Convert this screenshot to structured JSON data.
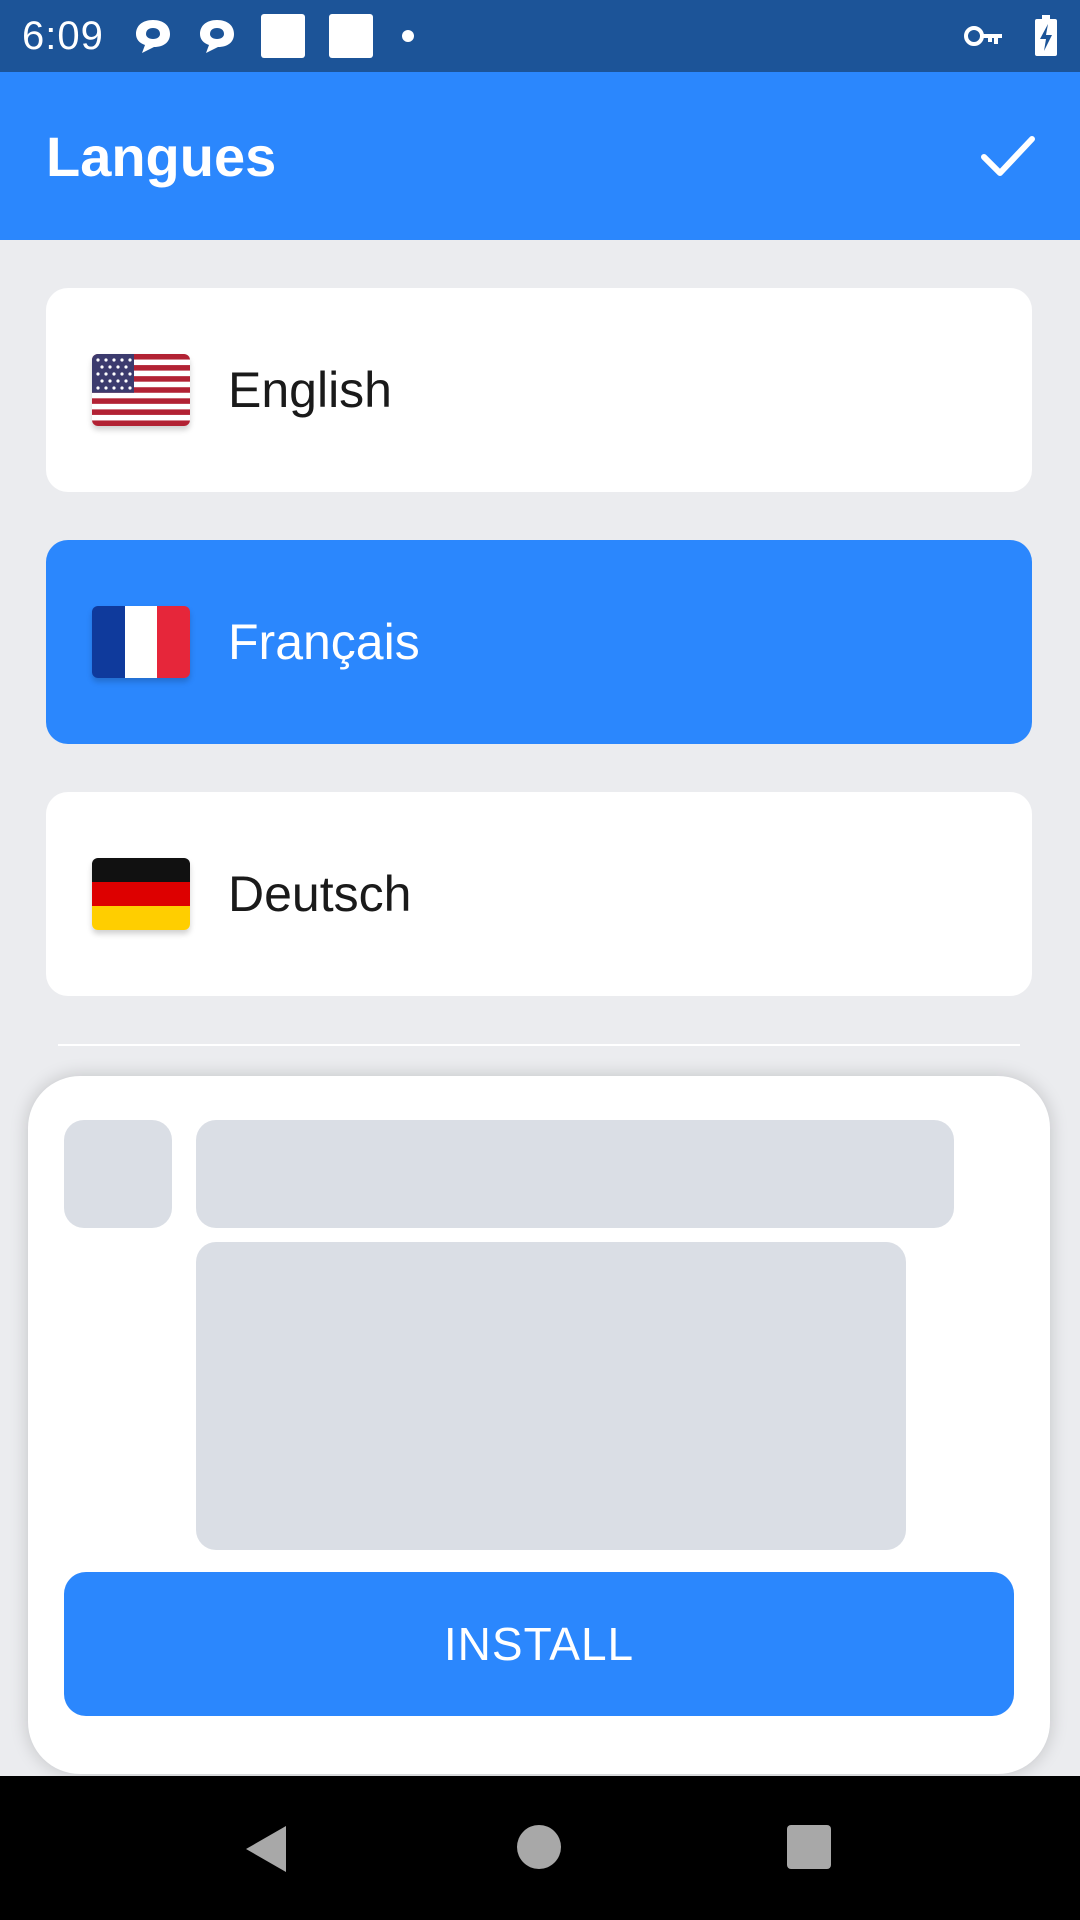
{
  "status_bar": {
    "time": "6:09",
    "icons_left": [
      "chat-bubble-icon",
      "chat-bubble-icon",
      "square-notification-icon",
      "square-notification-icon",
      "dot-icon"
    ],
    "icons_right": [
      "vpn-key-icon",
      "battery-charging-icon"
    ]
  },
  "app_bar": {
    "title": "Langues",
    "confirm_icon": "check-icon"
  },
  "languages": [
    {
      "label": "English",
      "flag": "us-flag-icon",
      "selected": false
    },
    {
      "label": "Français",
      "flag": "france-flag-icon",
      "selected": true
    },
    {
      "label": "Deutsch",
      "flag": "germany-flag-icon",
      "selected": false
    }
  ],
  "ad": {
    "install_label": "INSTALL"
  },
  "nav_bar": {
    "back_icon": "back-triangle-icon",
    "home_icon": "home-circle-icon",
    "recents_icon": "recents-square-icon"
  },
  "colors": {
    "primary": "#2b87fd",
    "status_bar": "#1c5498",
    "background": "#ebecef",
    "skeleton": "#dadee5"
  }
}
